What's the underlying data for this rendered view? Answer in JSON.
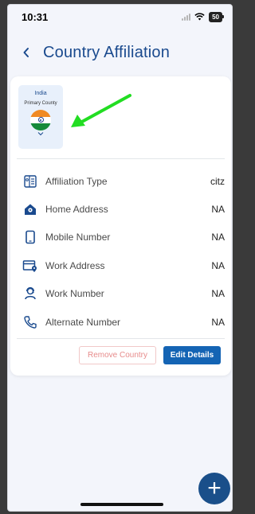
{
  "status_bar": {
    "time": "10:31",
    "battery": "50",
    "icons": [
      "signal-icon",
      "wifi-icon",
      "battery-icon"
    ]
  },
  "header": {
    "back_icon": "chevron-left-icon",
    "title": "Country Affiliation"
  },
  "country_tile": {
    "country": "India",
    "subtitle": "Primary County",
    "flag_icon": "india-flag-icon",
    "expand_icon": "chevron-down-icon"
  },
  "annotation": {
    "arrow_color": "#22dd22"
  },
  "details": [
    {
      "icon": "id-card-icon",
      "label": "Affiliation Type",
      "value": "citz"
    },
    {
      "icon": "home-icon",
      "label": "Home Address",
      "value": "NA"
    },
    {
      "icon": "mobile-phone-icon",
      "label": "Mobile Number",
      "value": "NA"
    },
    {
      "icon": "work-location-icon",
      "label": "Work Address",
      "value": "NA"
    },
    {
      "icon": "headset-icon",
      "label": "Work Number",
      "value": "NA"
    },
    {
      "icon": "phone-icon",
      "label": "Alternate Number",
      "value": "NA"
    }
  ],
  "actions": {
    "remove_label": "Remove Country",
    "edit_label": "Edit Details"
  },
  "fab": {
    "icon": "plus-icon",
    "label": "+"
  },
  "colors": {
    "primary": "#1a4a8e",
    "button_primary": "#1464b4",
    "danger_text": "#e78b8b",
    "background": "#f3f5fb"
  }
}
